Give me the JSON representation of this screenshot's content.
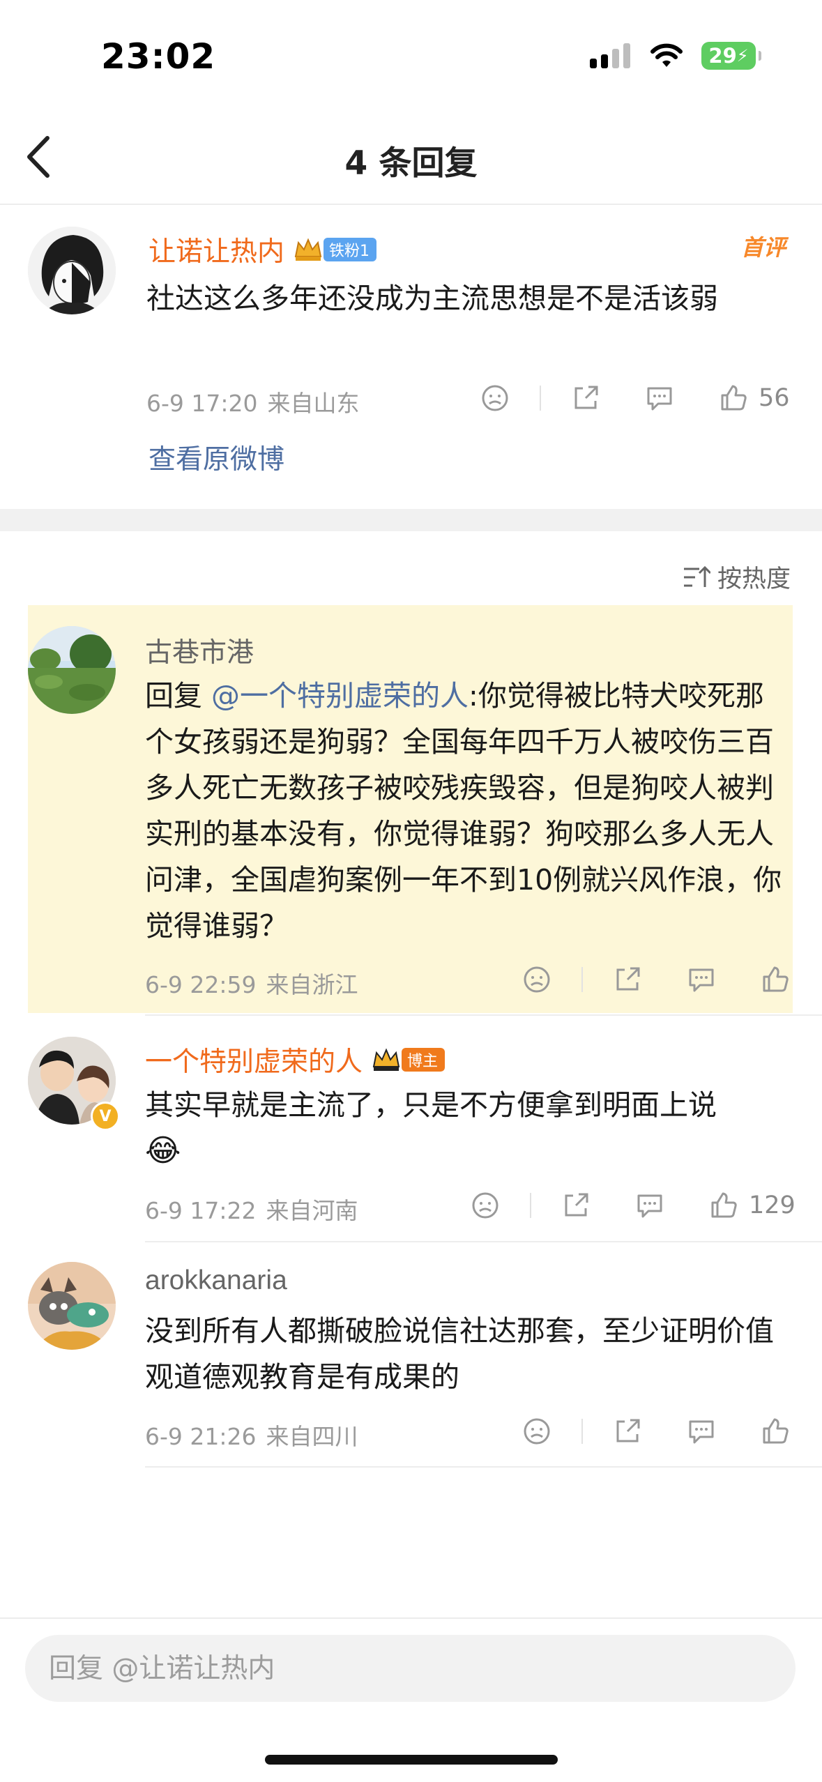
{
  "status_bar": {
    "time": "23:02",
    "battery": "29",
    "icons": [
      "cellular-signal-icon",
      "wifi-icon",
      "battery-charging-icon"
    ]
  },
  "header": {
    "title": "4 条回复",
    "back_icon": "chevron-left-icon"
  },
  "original_comment": {
    "author": "让诺让热内",
    "badge": "铁粉1",
    "first_tag": "首评",
    "text": "社达这么多年还没成为主流思想是不是活该弱",
    "date": "6-9 17:20",
    "location": "来自山东",
    "likes": "56",
    "view_original": "查看原微博"
  },
  "sort": {
    "label": "按热度"
  },
  "replies": [
    {
      "author": "古巷市港",
      "reply_prefix": "回复 ",
      "mention": "@一个特别虚荣的人",
      "text": ":你觉得被比特犬咬死那个女孩弱还是狗弱？全国每年四千万人被咬伤三百多人死亡无数孩子被咬残疾毁容，但是狗咬人被判实刑的基本没有，你觉得谁弱？狗咬那么多人无人问津，全国虐狗案例一年不到10例就兴风作浪，你觉得谁弱？",
      "date": "6-9 22:59",
      "location": "来自浙江",
      "likes": ""
    },
    {
      "author": "一个特别虚荣的人",
      "badge": "博主",
      "text": "其实早就是主流了，只是不方便拿到明面上说",
      "emoji": "😂",
      "date": "6-9 17:22",
      "location": "来自河南",
      "likes": "129"
    },
    {
      "author": "arokkanaria",
      "text": "没到所有人都撕破脸说信社达那套，至少证明价值观道德观教育是有成果的",
      "date": "6-9 21:26",
      "location": "来自四川",
      "likes": ""
    }
  ],
  "reply_bar": {
    "placeholder": "回复 @让诺让热内"
  },
  "colors": {
    "orange_name": "#f06a1c",
    "link": "#4e6ea2",
    "highlight": "#fdf7d8",
    "battery": "#5ecd61"
  }
}
